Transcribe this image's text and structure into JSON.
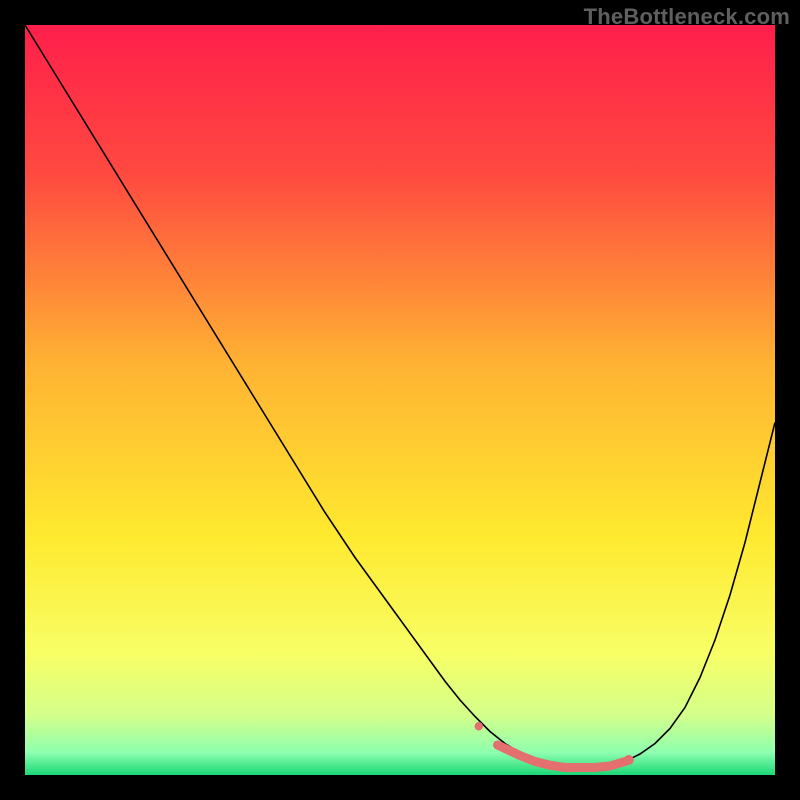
{
  "watermark": "TheBottleneck.com",
  "chart_data": {
    "type": "line",
    "title": "",
    "xlabel": "",
    "ylabel": "",
    "xlim": [
      0,
      100
    ],
    "ylim": [
      0,
      100
    ],
    "background_gradient_stops": [
      {
        "offset": 0.0,
        "color": "#ff1f4b"
      },
      {
        "offset": 0.2,
        "color": "#ff4a40"
      },
      {
        "offset": 0.45,
        "color": "#ffb233"
      },
      {
        "offset": 0.68,
        "color": "#ffe92f"
      },
      {
        "offset": 0.84,
        "color": "#f7ff66"
      },
      {
        "offset": 0.92,
        "color": "#d4ff8a"
      },
      {
        "offset": 0.97,
        "color": "#8effaf"
      },
      {
        "offset": 1.0,
        "color": "#1bd877"
      }
    ],
    "series": [
      {
        "name": "curve",
        "color": "#000000",
        "width": 1.6,
        "x": [
          0,
          4,
          8,
          12,
          16,
          20,
          24,
          28,
          32,
          36,
          40,
          44,
          48,
          52,
          56,
          58,
          60,
          62,
          64,
          66,
          68,
          70,
          72,
          74,
          76,
          78,
          80,
          82,
          84,
          86,
          88,
          90,
          92,
          94,
          96,
          98,
          100
        ],
        "y": [
          100,
          93.5,
          87,
          80.5,
          74,
          67.5,
          61,
          54.5,
          48,
          41.5,
          35,
          29,
          23.5,
          18,
          12.5,
          10,
          7.8,
          5.8,
          4.2,
          3.0,
          2.2,
          1.6,
          1.2,
          1.0,
          1.0,
          1.2,
          1.8,
          2.8,
          4.2,
          6.2,
          9.0,
          13.0,
          18.0,
          24.0,
          31.0,
          39.0,
          47.0
        ]
      },
      {
        "name": "optimal-marker",
        "color": "#e36f6f",
        "width": 9,
        "linecap": "round",
        "x": [
          63,
          66,
          68,
          70,
          72,
          74,
          76,
          78,
          80
        ],
        "y": [
          4.0,
          2.6,
          1.8,
          1.3,
          1.0,
          1.0,
          1.0,
          1.2,
          1.8
        ]
      }
    ],
    "points": [
      {
        "name": "marker-left-dot",
        "x": 60.5,
        "y": 6.5,
        "r": 4.2,
        "color": "#e36f6f"
      },
      {
        "name": "marker-right-dot",
        "x": 80.5,
        "y": 2.0,
        "r": 5.0,
        "color": "#e36f6f"
      }
    ]
  }
}
